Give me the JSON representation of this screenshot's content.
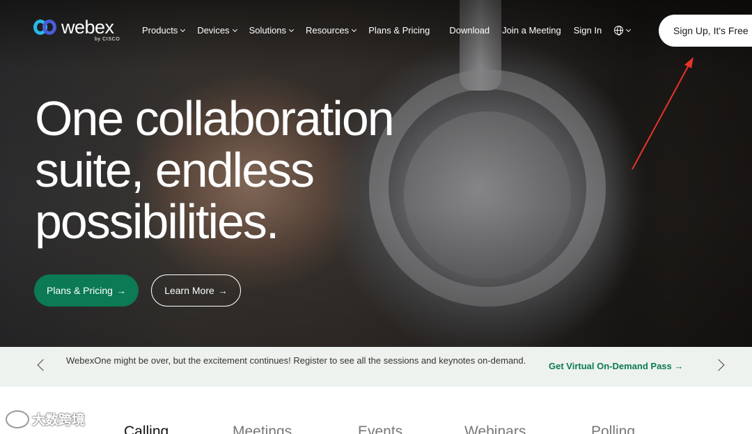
{
  "header": {
    "logo_text": "webex",
    "logo_sub": "by CISCO",
    "nav": [
      {
        "label": "Products",
        "has_menu": true
      },
      {
        "label": "Devices",
        "has_menu": true
      },
      {
        "label": "Solutions",
        "has_menu": true
      },
      {
        "label": "Resources",
        "has_menu": true
      },
      {
        "label": "Plans & Pricing",
        "has_menu": false
      },
      {
        "label": "Download",
        "has_menu": false
      },
      {
        "label": "Join a Meeting",
        "has_menu": false
      },
      {
        "label": "Sign In",
        "has_menu": false
      }
    ],
    "language_icon": "globe-icon",
    "signup_label": "Sign Up, It's Free"
  },
  "hero": {
    "headline_line1": "One collaboration",
    "headline_line2": "suite, endless",
    "headline_line3": "possibilities.",
    "primary_cta": "Plans & Pricing",
    "secondary_cta": "Learn More"
  },
  "banner": {
    "text": "WebexOne might be over, but the excitement continues! Register to see all the sessions and keynotes on-demand.",
    "link_label": "Get Virtual On-Demand Pass"
  },
  "tabs": [
    {
      "label": "Calling",
      "selected": true
    },
    {
      "label": "Meetings",
      "selected": false
    },
    {
      "label": "Events",
      "selected": false
    },
    {
      "label": "Webinars",
      "selected": false
    },
    {
      "label": "Polling",
      "selected": false
    }
  ],
  "watermark": {
    "text": "大数跨境"
  },
  "colors": {
    "brand_green": "#0b7a55",
    "banner_bg": "#eef2ee",
    "annotation_red": "#e8332a",
    "logo_blue": "#27b9e6",
    "logo_indigo": "#4b5bdb"
  }
}
